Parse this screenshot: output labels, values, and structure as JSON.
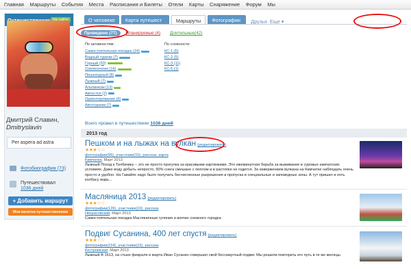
{
  "topnav": [
    "Главная",
    "Маршруты",
    "События",
    "Места",
    "Расписания и Билеты",
    "Отели",
    "Карты",
    "Снаряжение",
    "Форум",
    "Мы"
  ],
  "sidebar": {
    "title": "Путешественник",
    "badge": "На сайте",
    "name": "Дмитрий Славин,",
    "login": "Dmitryslavin",
    "motto": "Per aspera ad astra",
    "photos": "Фотобиография (73)",
    "travel_label": "Путешествовал",
    "travel_days": "1036 дней",
    "add_button": "+ Добавить маршрут",
    "card_button": "Моя визитка путешественника"
  },
  "tabs": [
    {
      "label": "О человеке",
      "active": false
    },
    {
      "label": "Карта путешест",
      "active": false
    },
    {
      "label": "Маршруты",
      "active": true
    },
    {
      "label": "Фотографии",
      "active": false
    }
  ],
  "tab_links": [
    "Друзья",
    "Еще ▾"
  ],
  "subtabs": {
    "done": "Проведено (77)",
    "planned": "Планируемые (4)",
    "long": "Длительные(42)"
  },
  "activity_header": "По активностям:",
  "difficulty_header": "По сложности:",
  "activities": [
    {
      "label": "Самостоятельная поездка (24)",
      "bar": 12,
      "green": false
    },
    {
      "label": "Водный туризм (7)",
      "bar": 16,
      "green": false
    },
    {
      "label": "Горный (20)",
      "bar": 22,
      "green": true
    },
    {
      "label": "Спелеология (16)",
      "bar": 20,
      "green": true
    },
    {
      "label": "Пешеходный (8)",
      "bar": 10,
      "green": false
    },
    {
      "label": "Лыжный (7)",
      "bar": 10,
      "green": false
    },
    {
      "label": "Альпинизм (13)",
      "bar": 10,
      "green": true
    },
    {
      "label": "Автостоп (2)",
      "bar": 9,
      "green": false
    },
    {
      "label": "Ориентирование (6)",
      "bar": 10,
      "green": false
    },
    {
      "label": "Автотуризм (7)",
      "bar": 10,
      "green": false
    }
  ],
  "difficulties": [
    "КС-1 (6)",
    "КС-2 (5)",
    "КС-3 (11)",
    "КС-5 (1)"
  ],
  "total": {
    "prefix": "Всего провел в путешествиях",
    "days": "1036 дней"
  },
  "year": "2013 год",
  "entries": [
    {
      "title": "Пешком и на лыжах на вулкан",
      "edit": "(редактировать)",
      "stars": "★★★☆☆",
      "meta": "фотографии(96), участники(15), рассказ, карта",
      "place": "Камчатка",
      "date": ", Март 2013",
      "desc": "Лыжный Поход к Толбачику – это не просто прогулка за красивыми картинками. Это ежеминутная борьба за выживание в суровых камчатских условиях. Даже воду добыть непросто, 90% снега смешано с пеплом и в растопке не годится. За извержением вулкана на Камчатке наблюдать очень просто и удобно. На Гавайях надо было получать бесчисленные разрешения и пропуска в специальные и заповедные зоны. А тут пришел и хоть колбасу жарь..."
    },
    {
      "title": "Масляница 2013",
      "edit": "(редактировать)",
      "stars": "★★★☆☆",
      "meta": "фотографии(126), участники(10), рассказ",
      "place": "Некрасовский",
      "date": ", Март 2013",
      "desc": "Самостоятельная поездка Масляничные гуляния и взятие снежного городка"
    },
    {
      "title": "Подвиг Сусанина, 400 лет спустя",
      "edit": "(редактировать)",
      "stars": "★★★☆☆",
      "meta": "фотографии(154), участники(15), рассказ",
      "place": "Костромская",
      "date": ", Март 2013",
      "desc": "Лыжный В 1613, на стыке февраля и марта Иван Сусанин совершил свой бессмертный подвиг. Мы решили повторить его путь в те же месяцы."
    }
  ],
  "colors": {
    "accent": "#2a7cb2",
    "highlight": "#e11111",
    "green": "#7dc24b",
    "orange": "#f2811f"
  }
}
